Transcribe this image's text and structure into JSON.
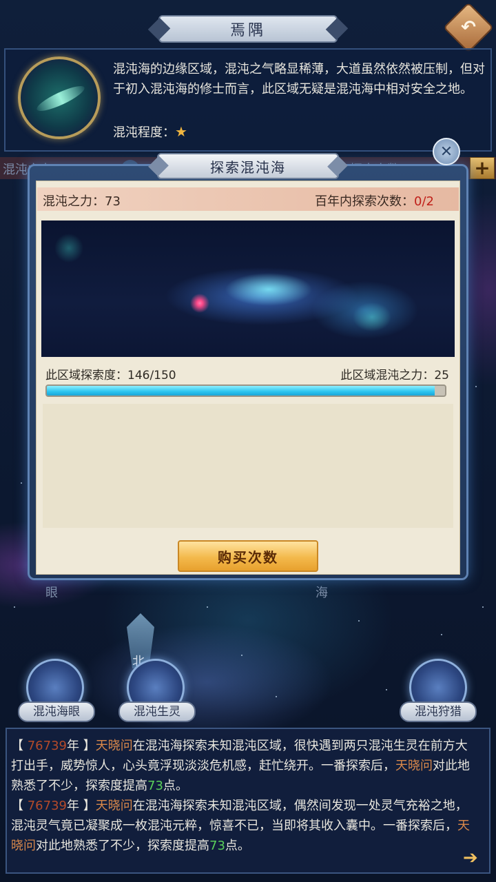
{
  "header": {
    "title": "焉隅"
  },
  "region": {
    "description": "混沌海的边缘区域，混沌之气略显稀薄，大道虽然依然被压制，但对于初入混沌海的修士而言，此区域无疑是混沌海中相对安全之地。",
    "level_label": "混沌程度：",
    "level_stars": 1
  },
  "background_stats": {
    "power": "混沌之力：73",
    "count_partial": "内探索次数："
  },
  "modal": {
    "title": "探索混沌海",
    "power_label": "混沌之力：73",
    "count_label": "百年内探索次数：",
    "count_value": "0/2",
    "explore_label": "此区域探索度：146/150",
    "region_power_label": "此区域混沌之力：25",
    "progress": {
      "current": 146,
      "max": 150
    },
    "buy_button": "购买次数"
  },
  "map": {
    "chars": [
      "眼",
      "海",
      "北"
    ],
    "nodes": [
      {
        "label": "混沌海眼"
      },
      {
        "label": "混沌生灵"
      },
      {
        "label": "混沌狩猎"
      }
    ]
  },
  "log": [
    {
      "year": "76739",
      "name": "天晓问",
      "text1": "在混沌海探索未知混沌区域，很快遇到两只混沌生灵在前方大打出手，威势惊人，心头竟浮现淡淡危机感，赶忙绕开。一番探索后，",
      "name2": "天晓问",
      "text2": "对此地熟悉了不少，探索度提高",
      "points": "73",
      "suffix": "点。"
    },
    {
      "year": "76739",
      "name": "天晓问",
      "text1": "在混沌海探索未知混沌区域，偶然间发现一处灵气充裕之地，混沌灵气竟已凝聚成一枚混沌元粹，惊喜不已，当即将其收入囊中。一番探索后，",
      "name2": "天晓问",
      "text2": "对此地熟悉了不少，探索度提高",
      "points": "73",
      "suffix": "点。"
    }
  ],
  "colors": {
    "year": "#b44a2a",
    "name": "#d8884a",
    "points": "#5ad05a",
    "count_value": "#c0201a"
  }
}
